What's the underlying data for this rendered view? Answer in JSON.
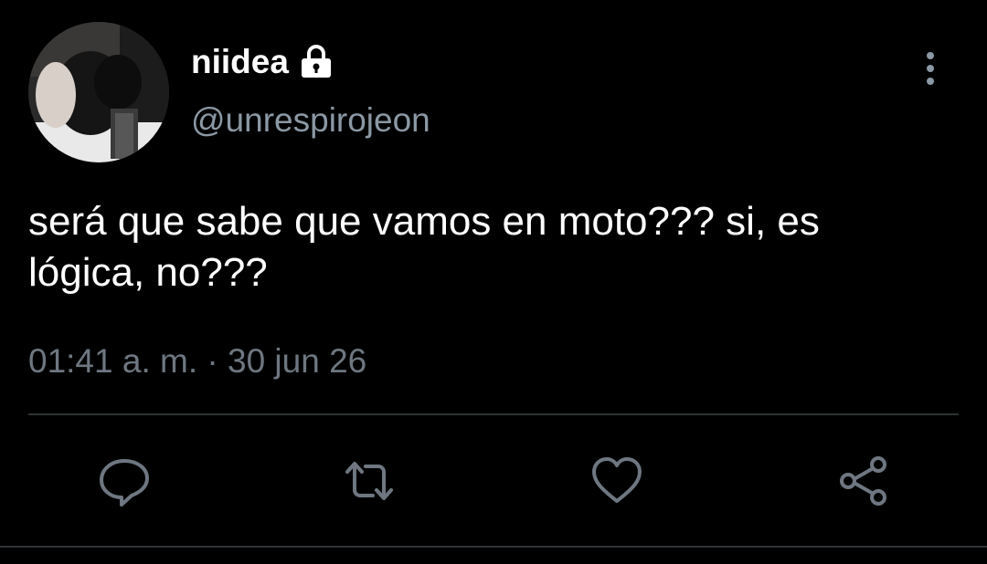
{
  "user": {
    "display_name": "niidea",
    "handle": "@unrespirojeon",
    "locked": true
  },
  "tweet": {
    "text_line1": "será que sabe que vamos en moto??? si, es",
    "text_line2": "lógica, no???",
    "timestamp": "01:41 a. m. · 30 jun 26"
  },
  "actions": {
    "reply_icon": "reply-bubble-icon",
    "retweet_icon": "retweet-icon",
    "like_icon": "heart-icon",
    "share_icon": "share-icon"
  },
  "colors": {
    "background": "#000000",
    "text_primary": "#ffffff",
    "text_secondary": "#8b98a5",
    "icon": "#6e7781",
    "divider": "#2f3336"
  }
}
